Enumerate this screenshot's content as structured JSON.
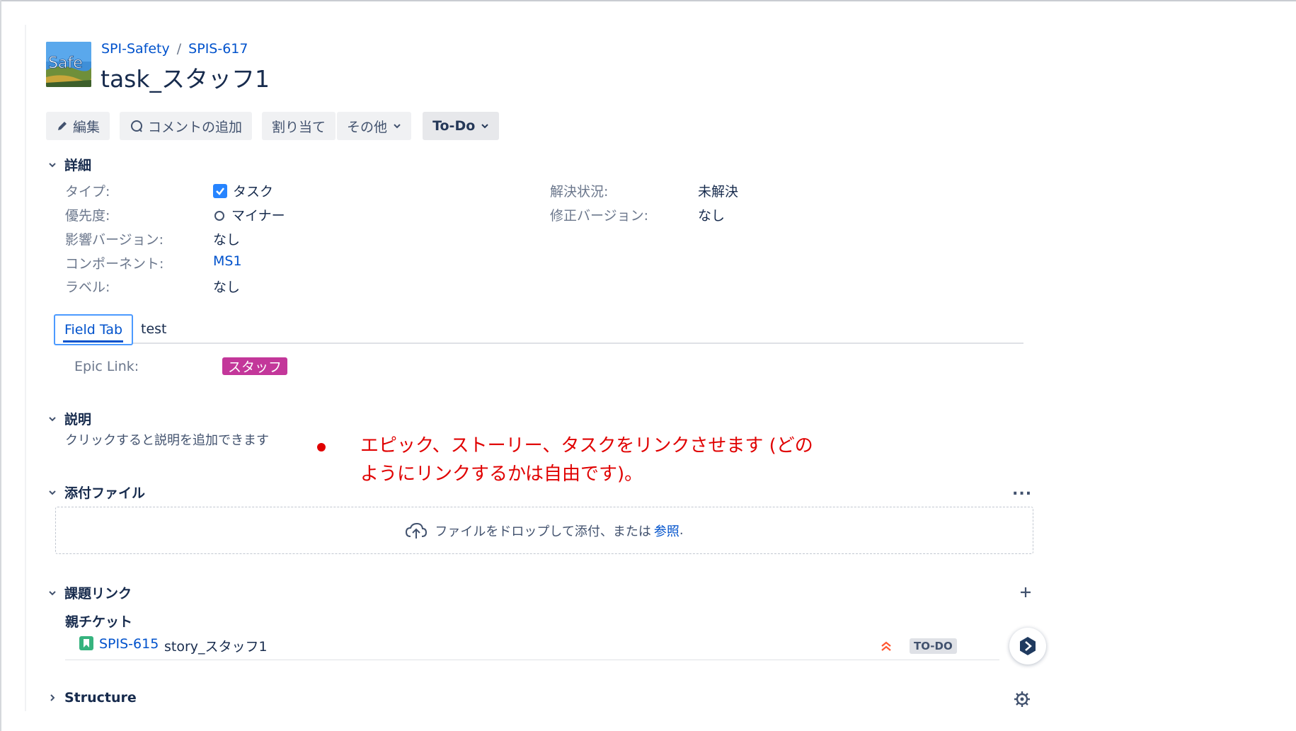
{
  "breadcrumbs": {
    "project": "SPI-Safety",
    "issue_key": "SPIS-617"
  },
  "avatar": {
    "text": "Safe"
  },
  "issue": {
    "title": "task_スタッフ1"
  },
  "toolbar": {
    "edit": "編集",
    "comment": "コメントの追加",
    "assign": "割り当て",
    "more": "その他",
    "status": "To-Do"
  },
  "sections": {
    "details": "詳細",
    "description": "説明",
    "attachments": "添付ファイル",
    "issue_links": "課題リンク",
    "structure": "Structure"
  },
  "details": {
    "type_label": "タイプ:",
    "type_value": "タスク",
    "priority_label": "優先度:",
    "priority_value": "マイナー",
    "affects_label": "影響バージョン:",
    "affects_value": "なし",
    "component_label": "コンポーネント:",
    "component_value": "MS1",
    "labels_label": "ラベル:",
    "labels_value": "なし",
    "resolution_label": "解決状況:",
    "resolution_value": "未解決",
    "fix_label": "修正バージョン:",
    "fix_value": "なし"
  },
  "tabs": {
    "active": "Field Tab",
    "other": "test"
  },
  "epic": {
    "label": "Epic Link:",
    "value": "スタッフ",
    "color": "#c3379a"
  },
  "description": {
    "placeholder": "クリックすると説明を追加できます"
  },
  "annotation": {
    "line1": "エピック、ストーリー、タスクをリンクさせます (どの",
    "line2": "ようにリンクするかは自由です)。",
    "color": "#e00000"
  },
  "attachments": {
    "more": "...",
    "drop_text": "ファイルをドロップして添付、または",
    "browse": "参照",
    "end": "."
  },
  "issue_links": {
    "parent_heading": "親チケット",
    "items": [
      {
        "key": "SPIS-615",
        "summary": "story_スタッフ1",
        "status": "TO-DO"
      }
    ]
  },
  "colors": {
    "link": "#0052cc",
    "text": "#172b4d",
    "muted": "#6b778c"
  }
}
